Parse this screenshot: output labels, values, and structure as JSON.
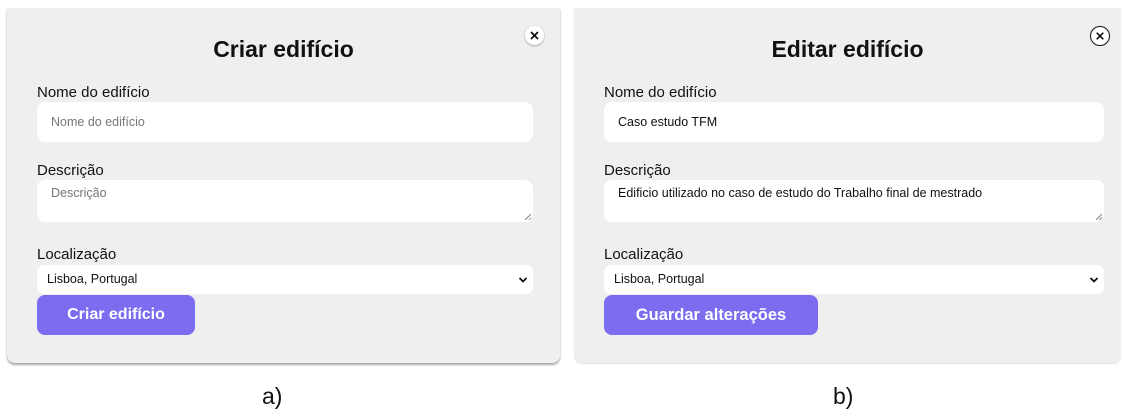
{
  "panel_a": {
    "title": "Criar edifício",
    "name_label": "Nome do edifício",
    "name_placeholder": "Nome do edifício",
    "description_label": "Descrição",
    "description_placeholder": "Descrição",
    "location_label": "Localização",
    "location_selected": "Lisboa, Portugal",
    "submit_label": "Criar edifício",
    "caption": "a)"
  },
  "panel_b": {
    "title": "Editar edifício",
    "name_label": "Nome do edifício",
    "name_value": "Caso estudo TFM",
    "description_label": "Descrição",
    "description_value": "Edificio utilizado no caso de estudo do Trabalho final de mestrado",
    "location_label": "Localização",
    "location_selected": "Lisboa, Portugal",
    "submit_label": "Guardar alterações",
    "caption": "b)"
  },
  "icons": {
    "close": "close-circle-icon",
    "dropdown": "chevron-down-icon"
  },
  "colors": {
    "accent": "#7b6cf0",
    "panel_background": "#efefef",
    "field_background": "#ffffff"
  }
}
